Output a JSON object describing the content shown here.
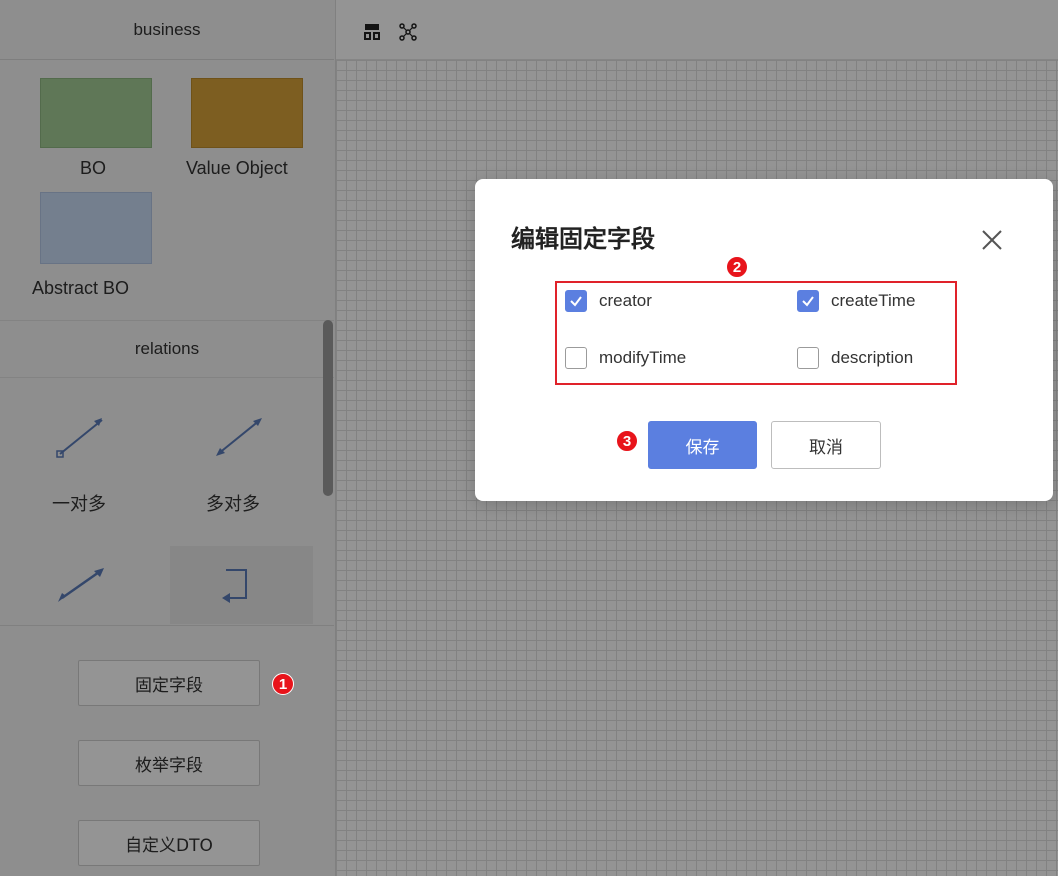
{
  "sidebar": {
    "business": {
      "title": "business",
      "shapes": [
        {
          "label": "BO",
          "color": "#a4cd96"
        },
        {
          "label": "Value Object",
          "color": "#d8a23a"
        },
        {
          "label": "Abstract BO",
          "color": "#c9dbf5"
        }
      ]
    },
    "relations": {
      "title": "relations",
      "items": [
        {
          "label": "一对多",
          "icon": "one-to-many-arrow-icon"
        },
        {
          "label": "多对多",
          "icon": "many-to-many-arrow-icon"
        },
        {
          "label": "",
          "icon": "association-arrow-icon"
        },
        {
          "label": "",
          "icon": "self-reference-arrow-icon"
        }
      ]
    },
    "buttons": {
      "fixed_fields": "固定字段",
      "enum_fields": "枚举字段",
      "custom_dto": "自定义DTO"
    }
  },
  "toolbar": {
    "icons": [
      "layout-icon",
      "graph-icon"
    ]
  },
  "dialog": {
    "title": "编辑固定字段",
    "fields": [
      {
        "label": "creator",
        "checked": true
      },
      {
        "label": "createTime",
        "checked": true
      },
      {
        "label": "modifyTime",
        "checked": false
      },
      {
        "label": "description",
        "checked": false
      }
    ],
    "save_label": "保存",
    "cancel_label": "取消"
  },
  "badges": {
    "step1": "1",
    "step2": "2",
    "step3": "3"
  },
  "colors": {
    "primary": "#5b7fe0",
    "highlight": "#e0222a",
    "badge": "#e8141b"
  }
}
